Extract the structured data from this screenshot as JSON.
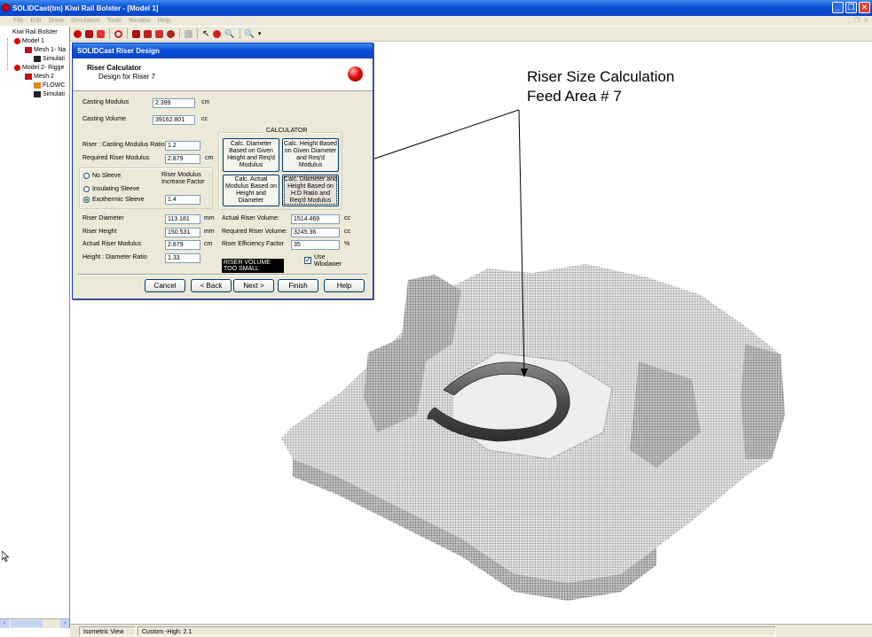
{
  "window": {
    "title": "SOLIDCast(tm) Kiwi Rail Bolster - [Model 1]",
    "controls": [
      "_",
      "❐",
      "✕"
    ],
    "mdi_controls": [
      "_",
      "❐",
      "✕"
    ]
  },
  "menu": [
    "File",
    "Edit",
    "Show",
    "Simulation",
    "Tools",
    "Window",
    "Help"
  ],
  "tree": {
    "root": "Kiwi Rail Bolster",
    "items": [
      "Model 1",
      "Mesh 1- Na",
      "Simulati",
      "Model 2- Rigge",
      "Mesh 2",
      "FLOWC",
      "Simulati"
    ]
  },
  "annotation": {
    "line1": "Riser Size Calculation",
    "line2": "Feed Area # 7"
  },
  "dialog": {
    "title": "SOLIDCast Riser Design",
    "heading": "Riser Calculator",
    "subheading": "Design for Riser 7",
    "casting_modulus": {
      "label": "Casting Modulus",
      "value": "2.399",
      "unit": "cm"
    },
    "casting_volume": {
      "label": "Casting Volume",
      "value": "39162.801",
      "unit": "cc"
    },
    "ratio": {
      "label": "Riser : Casting Modulus Ratio",
      "value": "1.2"
    },
    "required_modulus": {
      "label": "Required Riser Modulus",
      "value": "2.879",
      "unit": "cm"
    },
    "sleeve": {
      "no_sleeve": "No Sleeve",
      "insulating": "Insulating Sleeve",
      "exothermic": "Exothermic Sleeve",
      "factor_label_1": "Riser Modulus",
      "factor_label_2": "Increase Factor",
      "factor_value": "1.4",
      "selected": "exothermic"
    },
    "calculator": {
      "title": "CALCULATOR",
      "btn1": "Calc. Diameter Based on Given Height and Req'd Modulus",
      "btn2": "Calc. Height Based on Given Diameter and Req'd Modulus",
      "btn3": "Calc. Actual Modulus Based on Height and Diameter",
      "btn4": "Calc. Diameter and Height Based on H:D Ratio and Req'd Modulus"
    },
    "riser_diameter": {
      "label": "Riser Diameter",
      "value": "113.181",
      "unit": "mm"
    },
    "riser_height": {
      "label": "Riser Height",
      "value": "150.531",
      "unit": "mm"
    },
    "actual_modulus": {
      "label": "Actual Riser Modulus",
      "value": "2.879",
      "unit": "cm"
    },
    "hd_ratio": {
      "label": "Height : Diameter Ratio",
      "value": "1.33"
    },
    "actual_volume": {
      "label": "Actual Riser Volume:",
      "value": "1514.469",
      "unit": "cc"
    },
    "required_volume": {
      "label": "Required Riser Volume:",
      "value": "3245.36",
      "unit": "cc"
    },
    "efficiency": {
      "label": "Riser Efficiency Factor",
      "value": "35",
      "unit": "%"
    },
    "warning": "RISER VOLUME TOO SMALL",
    "use_wlodawer": {
      "line1": "Use",
      "line2": "Wlodawer",
      "checked": true
    },
    "buttons": {
      "cancel": "Cancel",
      "back": "< Back",
      "next": "Next >",
      "finish": "Finish",
      "help": "Help"
    }
  },
  "status": {
    "view": "Isometric View",
    "mode": "Custom -High: 2.1"
  }
}
